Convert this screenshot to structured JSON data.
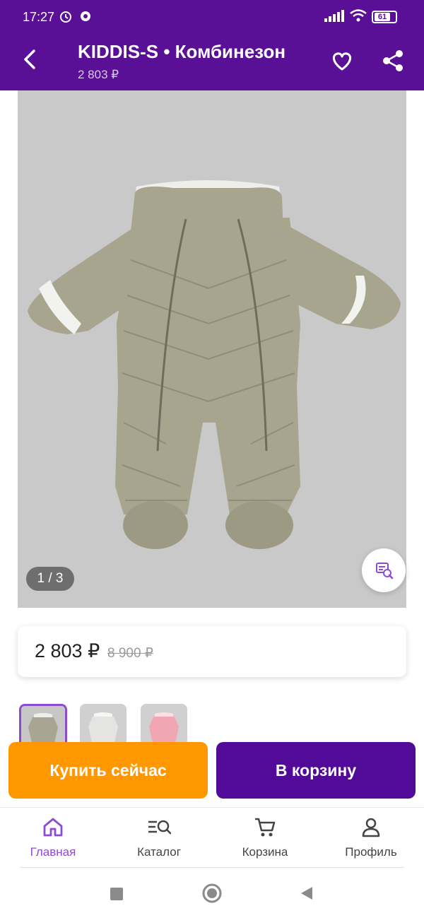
{
  "status_bar": {
    "time": "17:27",
    "battery": "61"
  },
  "header": {
    "title": "KIDDIS-S • Комбинезон",
    "subtitle": "2 803 ₽"
  },
  "gallery": {
    "counter": "1 / 3"
  },
  "price": {
    "current": "2 803 ₽",
    "old": "8 900 ₽"
  },
  "thumbnails": [
    {
      "color": "#a8a693"
    },
    {
      "color": "#e4e4e2"
    },
    {
      "color": "#f1a6b4"
    }
  ],
  "actions": {
    "buy_now": "Купить сейчас",
    "add_to_cart": "В корзину"
  },
  "bottom_nav": [
    {
      "label": "Главная",
      "icon": "home-icon"
    },
    {
      "label": "Каталог",
      "icon": "catalog-search-icon"
    },
    {
      "label": "Корзина",
      "icon": "cart-icon"
    },
    {
      "label": "Профиль",
      "icon": "profile-icon"
    }
  ],
  "colors": {
    "brand": "#5a0f97",
    "accent": "#8e4bd1",
    "buy": "#ff9800",
    "cart": "#520b98"
  }
}
